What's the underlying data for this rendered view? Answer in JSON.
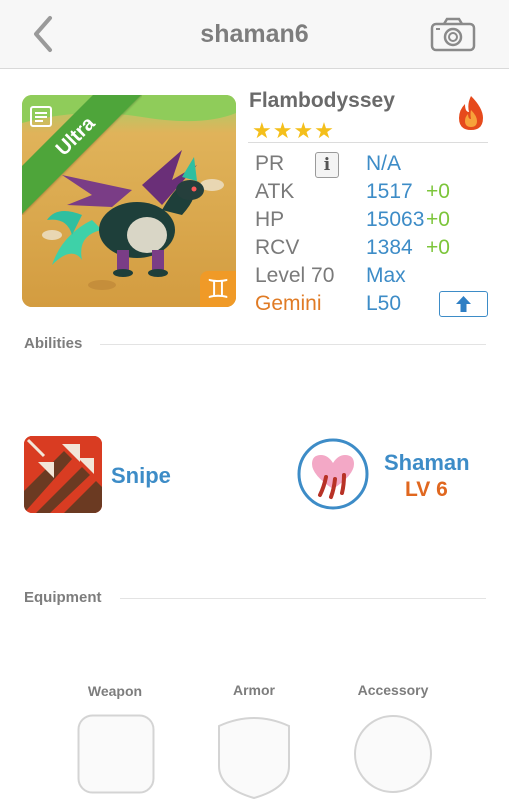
{
  "header": {
    "title": "shaman6"
  },
  "dragon": {
    "rarity": "Ultra",
    "name": "Flambodyssey",
    "stars": "★★★★",
    "element_icon": "fire-icon",
    "zodiac_glyph": "♊",
    "stats": {
      "pr_label": "PR",
      "pr_value": "N/A",
      "atk_label": "ATK",
      "atk_value": "1517",
      "atk_bonus": "+0",
      "hp_label": "HP",
      "hp_value": "15063",
      "hp_bonus": "+0",
      "rcv_label": "RCV",
      "rcv_value": "1384",
      "rcv_bonus": "+0",
      "level_label": "Level 70",
      "level_value": "Max",
      "zodiac_label": "Gemini",
      "zodiac_value": "L50"
    }
  },
  "abilities": {
    "title": "Abilities",
    "items": [
      {
        "name": "Snipe",
        "icon": "snipe-icon"
      },
      {
        "name": "Shaman",
        "level": "LV 6",
        "icon": "shaman-heart-icon"
      }
    ]
  },
  "equipment": {
    "title": "Equipment",
    "slots": [
      {
        "label": "Weapon"
      },
      {
        "label": "Armor"
      },
      {
        "label": "Accessory"
      }
    ]
  },
  "colors": {
    "accent_blue": "#3d8cc7",
    "bonus_green": "#7cc53a",
    "orange": "#e07b25",
    "ultra_green": "#4ea53a",
    "star_gold": "#f4bf1b"
  }
}
